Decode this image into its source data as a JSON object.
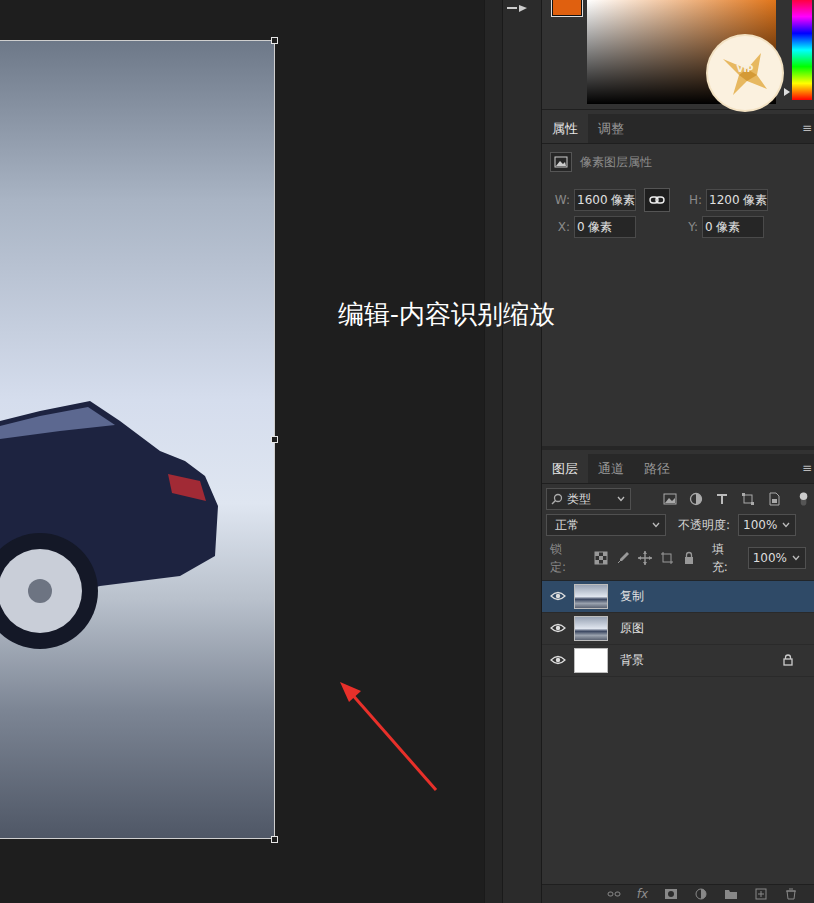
{
  "canvas": {
    "annotation": "编辑-内容识别缩放"
  },
  "color_picker": {
    "badge": "VIP"
  },
  "properties": {
    "tabs": [
      {
        "label": "属性",
        "selected": true
      },
      {
        "label": "调整",
        "selected": false
      }
    ],
    "menu": "≡",
    "title": "像素图层属性",
    "width": {
      "label": "W:",
      "value": "1600 像素"
    },
    "height": {
      "label": "H:",
      "value": "1200 像素"
    },
    "x": {
      "label": "X:",
      "value": "0 像素"
    },
    "y": {
      "label": "Y:",
      "value": "0 像素"
    },
    "linked": true
  },
  "layers_panel": {
    "tabs": [
      {
        "label": "图层",
        "selected": true
      },
      {
        "label": "通道",
        "selected": false
      },
      {
        "label": "路径",
        "selected": false
      }
    ],
    "menu": "≡",
    "filter": "类型",
    "blend_mode": "正常",
    "opacity_label": "不透明度:",
    "opacity": "100%",
    "lock_label": "锁定:",
    "fill_label": "填充:",
    "fill": "100%",
    "layers": [
      {
        "name": "复制",
        "selected": true,
        "visible": true,
        "locked": false,
        "kind": "photo"
      },
      {
        "name": "原图",
        "selected": false,
        "visible": true,
        "locked": false,
        "kind": "photo"
      },
      {
        "name": "背景",
        "selected": false,
        "visible": true,
        "locked": true,
        "kind": "white"
      }
    ],
    "footer": "fx"
  }
}
